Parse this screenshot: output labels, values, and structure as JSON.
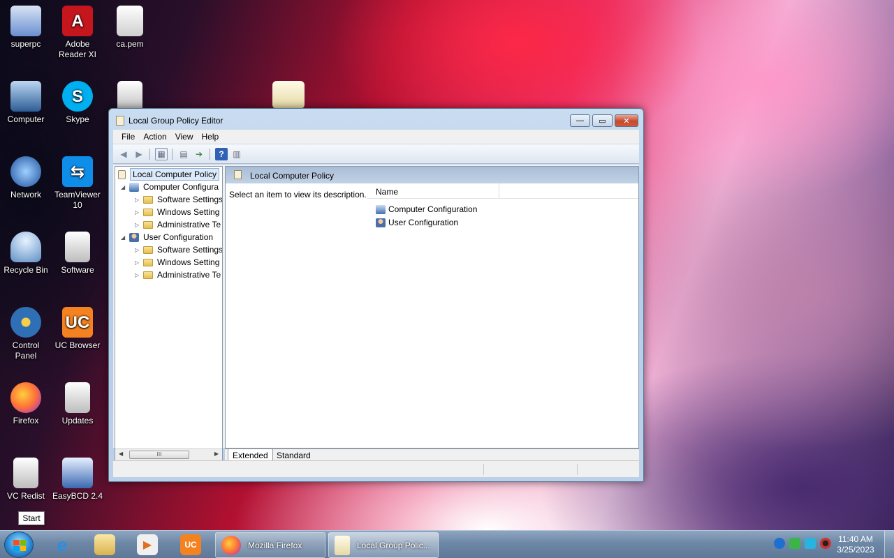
{
  "desktop": {
    "icons": [
      {
        "label": "superpc",
        "icon": "user-folder-icon",
        "color": "#6a8fd0"
      },
      {
        "label": "Adobe\nReader XI",
        "icon": "adobe-reader-icon",
        "color": "#c4161c"
      },
      {
        "label": "ca.pem",
        "icon": "certificate-file-icon",
        "color": "#e6e6e6"
      },
      {
        "label": "Computer",
        "icon": "computer-icon",
        "color": "#4a7ab8"
      },
      {
        "label": "Skype",
        "icon": "skype-icon",
        "color": "#00aff0"
      },
      {
        "label": "Network",
        "icon": "network-icon",
        "color": "#3b6fc4"
      },
      {
        "label": "TeamViewer\n10",
        "icon": "teamviewer-icon",
        "color": "#0e8ee9"
      },
      {
        "label": "Recycle Bin",
        "icon": "recycle-bin-icon",
        "color": "#8fb6d8"
      },
      {
        "label": "Software",
        "icon": "folder-icon",
        "color": "#d9d9d9"
      },
      {
        "label": "Control\nPanel",
        "icon": "control-panel-icon",
        "color": "#2f6fb5"
      },
      {
        "label": "UC Browser",
        "icon": "uc-browser-icon",
        "color": "#f58220"
      },
      {
        "label": "Firefox",
        "icon": "firefox-icon",
        "color": "#ff7139"
      },
      {
        "label": "Updates",
        "icon": "folder-icon",
        "color": "#d9d9d9"
      },
      {
        "label": "VC Redist",
        "icon": "folder-icon",
        "color": "#d9d9d9"
      },
      {
        "label": "EasyBCD 2.4",
        "icon": "easybcd-icon",
        "color": "#3a68b0"
      }
    ]
  },
  "window": {
    "title": "Local Group Policy Editor",
    "buttons": {
      "minimize": "—",
      "maximize": "▭",
      "close": "✕"
    },
    "menu": [
      "File",
      "Action",
      "View",
      "Help"
    ],
    "tree": [
      {
        "label": "Local Computer Policy",
        "level": 0,
        "arrow": "",
        "icon": "policy-icon"
      },
      {
        "label": "Computer Configura",
        "level": 1,
        "arrow": "◢",
        "icon": "computer-config-icon"
      },
      {
        "label": "Software Settings",
        "level": 2,
        "arrow": "▷",
        "icon": "folder-icon"
      },
      {
        "label": "Windows Setting",
        "level": 2,
        "arrow": "▷",
        "icon": "folder-icon"
      },
      {
        "label": "Administrative Te",
        "level": 2,
        "arrow": "▷",
        "icon": "folder-icon"
      },
      {
        "label": "User Configuration",
        "level": 1,
        "arrow": "◢",
        "icon": "user-config-icon"
      },
      {
        "label": "Software Settings",
        "level": 2,
        "arrow": "▷",
        "icon": "folder-icon"
      },
      {
        "label": "Windows Setting",
        "level": 2,
        "arrow": "▷",
        "icon": "folder-icon"
      },
      {
        "label": "Administrative Te",
        "level": 2,
        "arrow": "▷",
        "icon": "folder-icon"
      }
    ],
    "scroll_thumb": "III",
    "right_header": "Local Computer Policy",
    "description": "Select an item to view its description.",
    "list_column": "Name",
    "list_items": [
      "Computer Configuration",
      "User Configuration"
    ],
    "tabs": [
      "Extended",
      "Standard"
    ]
  },
  "tooltip": "Start",
  "taskbar": {
    "tasks": [
      "Mozilla Firefox",
      "Local Group Polic..."
    ],
    "clock_time": "11:40 AM",
    "clock_date": "3/25/2023"
  }
}
